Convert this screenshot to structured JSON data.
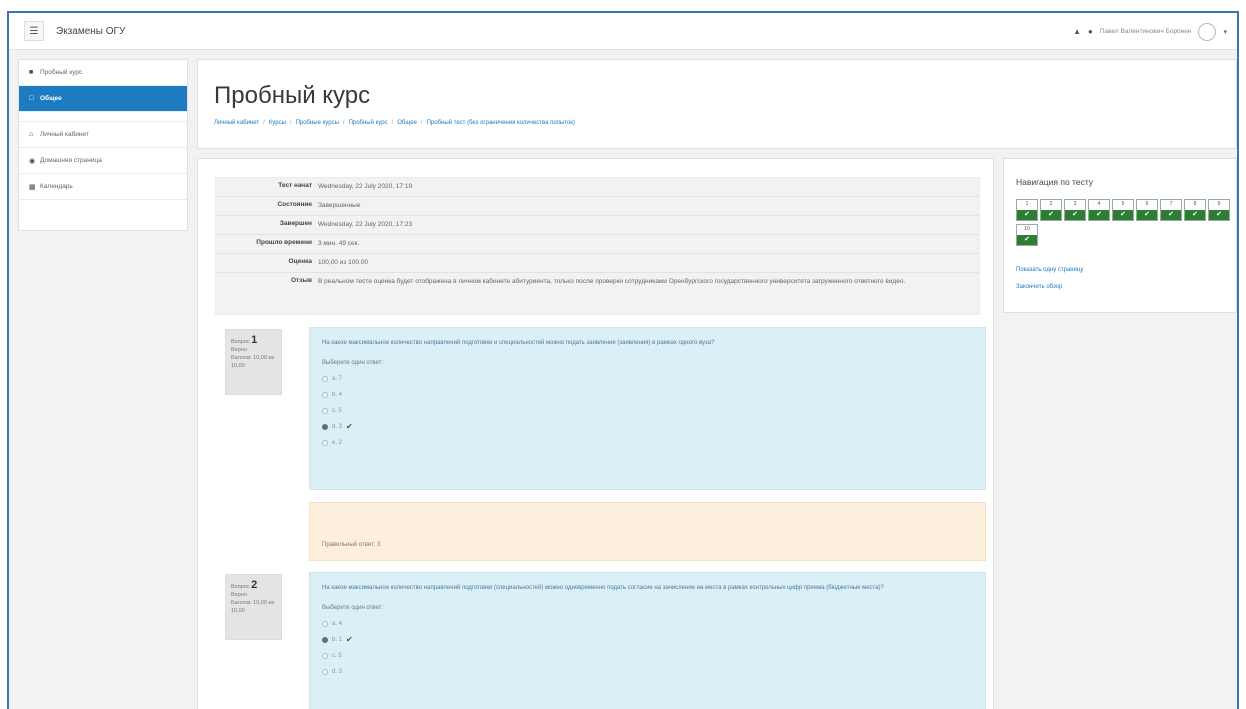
{
  "navbar": {
    "site_name": "Экзамены ОГУ",
    "user_name": "Павел Валентинович Боронин"
  },
  "sidebar": {
    "items": [
      {
        "label": "Пробный курс",
        "icon": "graduation-cap-icon"
      },
      {
        "label": "Общее",
        "icon": "folder-icon",
        "active": true
      },
      {
        "label": "Личный кабинет",
        "icon": "home-icon"
      },
      {
        "label": "Домашняя страница",
        "icon": "globe-icon"
      },
      {
        "label": "Календарь",
        "icon": "calendar-icon"
      }
    ]
  },
  "header": {
    "title": "Пробный курс",
    "breadcrumb": [
      "Личный кабинет",
      "Курсы",
      "Пробные курсы",
      "Пробный курс",
      "Общее",
      "Пробный тест (без ограничения количества попыток)"
    ]
  },
  "summary": [
    {
      "key": "Тест начат",
      "value": "Wednesday, 22 July 2020, 17:19"
    },
    {
      "key": "Состояние",
      "value": "Завершенные"
    },
    {
      "key": "Завершен",
      "value": "Wednesday, 22 July 2020, 17:23"
    },
    {
      "key": "Прошло времени",
      "value": "3 мин. 49 сек."
    },
    {
      "key": "Оценка",
      "value": "100,00 из 100,00"
    },
    {
      "key": "Отзыв",
      "value": "В реальном тесте оценка будет отображена в личном кабинете абитуриента, только после проверки сотрудниками Оренбургского государственного университета загруженного ответного видео."
    }
  ],
  "questions": [
    {
      "label": "Вопрос",
      "number": "1",
      "status": "Верно",
      "marks": "Баллов: 10,00 из 10,00",
      "text": "На какое максимальное количество направлений подготовки и специальностей можно подать заявление (заявления) в рамках одного вуза?",
      "prompt": "Выберите один ответ:",
      "options": [
        {
          "label": "a. 7",
          "selected": false
        },
        {
          "label": "b. 4",
          "selected": false
        },
        {
          "label": "c. 5",
          "selected": false
        },
        {
          "label": "d. 3",
          "selected": true
        },
        {
          "label": "e. 2",
          "selected": false
        }
      ],
      "feedback": "Правильный ответ: 3"
    },
    {
      "label": "Вопрос",
      "number": "2",
      "status": "Верно",
      "marks": "Баллов: 10,00 из 10,00",
      "text": "На какое максимальное количество направлений подготовки (специальностей) можно одновременно подать согласие на зачисление на места в рамках контрольных цифр приема (бюджетные места)?",
      "prompt": "Выберите один ответ:",
      "options": [
        {
          "label": "a. 4",
          "selected": false
        },
        {
          "label": "b. 1",
          "selected": true
        },
        {
          "label": "c. 5",
          "selected": false
        },
        {
          "label": "d. 3",
          "selected": false
        }
      ]
    }
  ],
  "quiz_nav": {
    "title": "Навигация по тесту",
    "buttons": [
      "1",
      "2",
      "3",
      "4",
      "5",
      "6",
      "7",
      "8",
      "9",
      "10"
    ],
    "show_one_page": "Показать одну страницу",
    "finish_review": "Закончить обзор"
  },
  "colors": {
    "primary": "#1d7bc1",
    "question_bg": "#dbeff7",
    "feedback_bg": "#fcefdc",
    "correct": "#2e7d32"
  }
}
